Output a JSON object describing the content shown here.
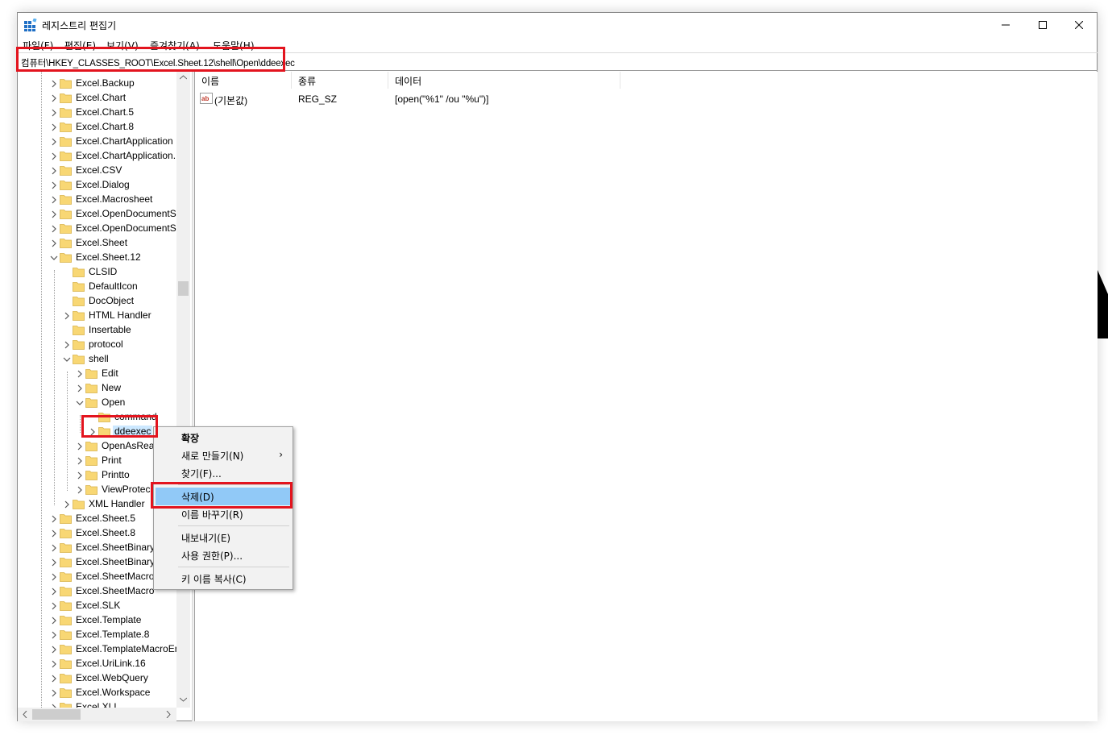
{
  "window": {
    "title": "레지스트리 편집기"
  },
  "menu": [
    "파일(F)",
    "편집(E)",
    "보기(V)",
    "즐겨찾기(A)",
    "도움말(H)"
  ],
  "address": "컴퓨터\\HKEY_CLASSES_ROOT\\Excel.Sheet.12\\shell\\Open\\ddeexec",
  "tree": [
    {
      "label": "Excel.Backup",
      "level": 0,
      "expander": "collapsed"
    },
    {
      "label": "Excel.Chart",
      "level": 0,
      "expander": "collapsed"
    },
    {
      "label": "Excel.Chart.5",
      "level": 0,
      "expander": "collapsed"
    },
    {
      "label": "Excel.Chart.8",
      "level": 0,
      "expander": "collapsed"
    },
    {
      "label": "Excel.ChartApplication",
      "level": 0,
      "expander": "collapsed"
    },
    {
      "label": "Excel.ChartApplication.",
      "level": 0,
      "expander": "collapsed"
    },
    {
      "label": "Excel.CSV",
      "level": 0,
      "expander": "collapsed"
    },
    {
      "label": "Excel.Dialog",
      "level": 0,
      "expander": "collapsed"
    },
    {
      "label": "Excel.Macrosheet",
      "level": 0,
      "expander": "collapsed"
    },
    {
      "label": "Excel.OpenDocumentS",
      "level": 0,
      "expander": "collapsed"
    },
    {
      "label": "Excel.OpenDocumentS",
      "level": 0,
      "expander": "collapsed"
    },
    {
      "label": "Excel.Sheet",
      "level": 0,
      "expander": "collapsed"
    },
    {
      "label": "Excel.Sheet.12",
      "level": 0,
      "expander": "expanded"
    },
    {
      "label": "CLSID",
      "level": 1,
      "expander": "none"
    },
    {
      "label": "DefaultIcon",
      "level": 1,
      "expander": "none"
    },
    {
      "label": "DocObject",
      "level": 1,
      "expander": "none"
    },
    {
      "label": "HTML Handler",
      "level": 1,
      "expander": "collapsed"
    },
    {
      "label": "Insertable",
      "level": 1,
      "expander": "none"
    },
    {
      "label": "protocol",
      "level": 1,
      "expander": "collapsed"
    },
    {
      "label": "shell",
      "level": 1,
      "expander": "expanded"
    },
    {
      "label": "Edit",
      "level": 2,
      "expander": "collapsed"
    },
    {
      "label": "New",
      "level": 2,
      "expander": "collapsed"
    },
    {
      "label": "Open",
      "level": 2,
      "expander": "expanded"
    },
    {
      "label": "command",
      "level": 3,
      "expander": "none"
    },
    {
      "label": "ddeexec",
      "level": 3,
      "expander": "collapsed",
      "selected": true
    },
    {
      "label": "OpenAsRea",
      "level": 2,
      "expander": "collapsed"
    },
    {
      "label": "Print",
      "level": 2,
      "expander": "collapsed"
    },
    {
      "label": "Printto",
      "level": 2,
      "expander": "collapsed"
    },
    {
      "label": "ViewProtec",
      "level": 2,
      "expander": "collapsed"
    },
    {
      "label": "XML Handler",
      "level": 1,
      "expander": "collapsed"
    },
    {
      "label": "Excel.Sheet.5",
      "level": 0,
      "expander": "collapsed"
    },
    {
      "label": "Excel.Sheet.8",
      "level": 0,
      "expander": "collapsed"
    },
    {
      "label": "Excel.SheetBinary",
      "level": 0,
      "expander": "collapsed"
    },
    {
      "label": "Excel.SheetBinary",
      "level": 0,
      "expander": "collapsed"
    },
    {
      "label": "Excel.SheetMacro",
      "level": 0,
      "expander": "collapsed"
    },
    {
      "label": "Excel.SheetMacro",
      "level": 0,
      "expander": "collapsed"
    },
    {
      "label": "Excel.SLK",
      "level": 0,
      "expander": "collapsed"
    },
    {
      "label": "Excel.Template",
      "level": 0,
      "expander": "collapsed"
    },
    {
      "label": "Excel.Template.8",
      "level": 0,
      "expander": "collapsed"
    },
    {
      "label": "Excel.TemplateMacroEr",
      "level": 0,
      "expander": "collapsed"
    },
    {
      "label": "Excel.UriLink.16",
      "level": 0,
      "expander": "collapsed"
    },
    {
      "label": "Excel.WebQuery",
      "level": 0,
      "expander": "collapsed"
    },
    {
      "label": "Excel.Workspace",
      "level": 0,
      "expander": "collapsed"
    },
    {
      "label": "Excel.XLL",
      "level": 0,
      "expander": "collapsed"
    }
  ],
  "list": {
    "columns": [
      "이름",
      "종류",
      "데이터"
    ],
    "rows": [
      {
        "icon": "ab",
        "name": "(기본값)",
        "type": "REG_SZ",
        "data": "[open(\"%1\" /ou \"%u\")]"
      }
    ]
  },
  "context_menu": [
    {
      "label": "확장",
      "bold": true
    },
    {
      "label": "새로 만들기(N)",
      "submenu": true
    },
    {
      "label": "찾기(F)..."
    },
    {
      "separator": true
    },
    {
      "label": "삭제(D)",
      "highlighted": true
    },
    {
      "label": "이름 바꾸기(R)"
    },
    {
      "separator": true
    },
    {
      "label": "내보내기(E)"
    },
    {
      "label": "사용 권한(P)..."
    },
    {
      "separator": true
    },
    {
      "label": "키 이름 복사(C)"
    }
  ],
  "colors": {
    "highlight": "#91c9f7",
    "selection": "#cce8ff",
    "annotation": "#e3141e",
    "folder": "#f8d774"
  }
}
